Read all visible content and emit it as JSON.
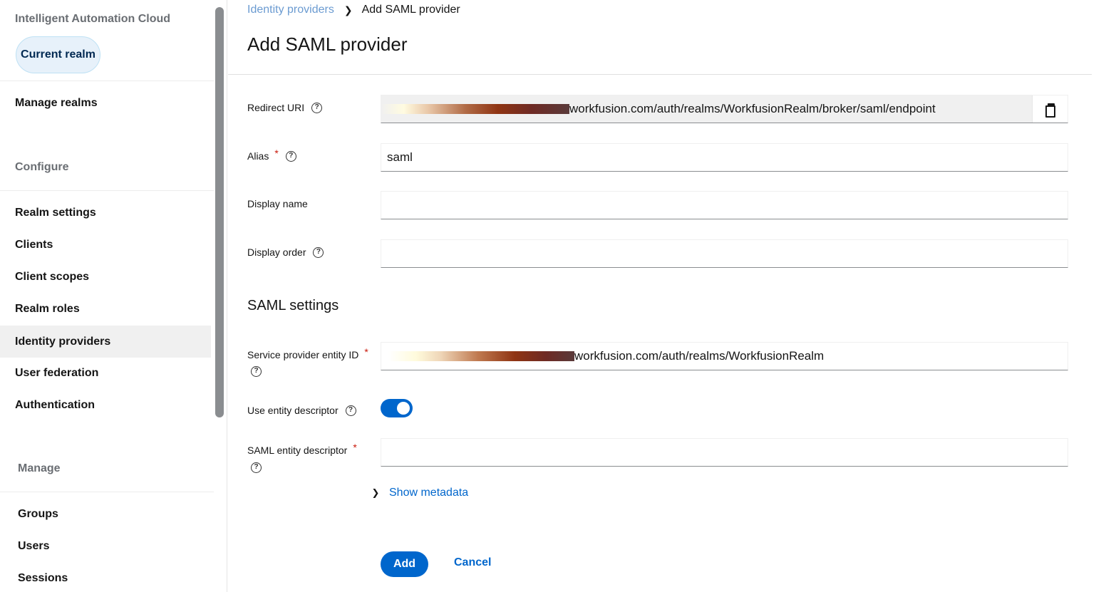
{
  "sidebar": {
    "realm_title": "Intelligent Automation Cloud",
    "current_realm": "Current realm",
    "manage_realms": "Manage realms",
    "configure_heading": "Configure",
    "configure_items": [
      "Realm settings",
      "Clients",
      "Client scopes",
      "Realm roles",
      "Identity providers",
      "User federation",
      "Authentication"
    ],
    "manage_heading": "Manage",
    "manage_items": [
      "Groups",
      "Users",
      "Sessions"
    ],
    "active_item": "Identity providers"
  },
  "breadcrumb": {
    "parent": "Identity providers",
    "current": "Add SAML provider"
  },
  "page": {
    "title": "Add SAML provider"
  },
  "form": {
    "redirect_uri": {
      "label": "Redirect URI",
      "value_visible": "workfusion.com/auth/realms/WorkfusionRealm/broker/saml/endpoint"
    },
    "alias": {
      "label": "Alias",
      "value": "saml",
      "required": true
    },
    "display_name": {
      "label": "Display name",
      "value": ""
    },
    "display_order": {
      "label": "Display order",
      "value": ""
    },
    "saml_settings_title": "SAML settings",
    "sp_entity_id": {
      "label": "Service provider entity ID",
      "value_visible": "workfusion.com/auth/realms/WorkfusionRealm",
      "required": true
    },
    "use_entity_descriptor": {
      "label": "Use entity descriptor",
      "enabled": true
    },
    "saml_entity_descriptor": {
      "label": "SAML entity descriptor",
      "value": "",
      "required": true
    },
    "show_metadata": "Show metadata"
  },
  "actions": {
    "add": "Add",
    "cancel": "Cancel"
  },
  "colors": {
    "primary": "#0066cc",
    "required": "#c9190b",
    "active_nav_bg": "#f0f0f0"
  }
}
